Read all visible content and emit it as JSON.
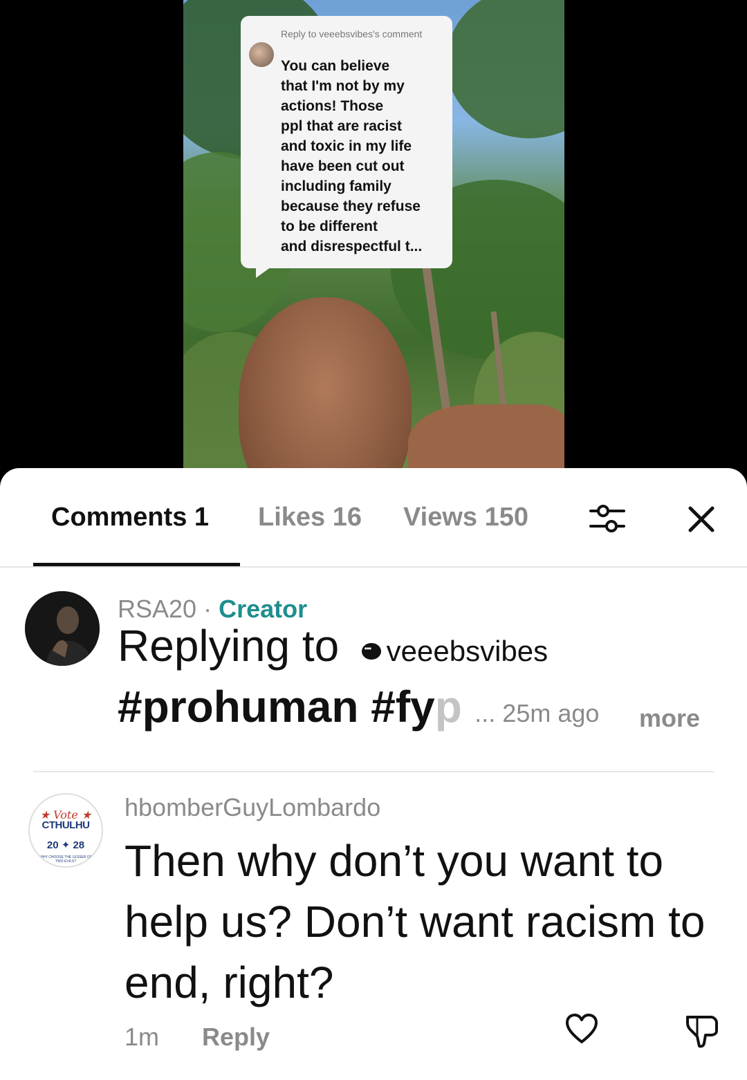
{
  "video": {
    "reply_bubble": {
      "header": "Reply to veeebsvibes's comment",
      "text": "You can believe\nthat I'm not by my\nactions! Those\nppl that are racist\nand toxic in my life\nhave been cut out\nincluding family\nbecause they refuse\nto be different\nand disrespectful t..."
    }
  },
  "tabs": {
    "comments": "Comments 1",
    "likes": "Likes 16",
    "views": "Views 150",
    "filter_icon": "sliders-icon",
    "close_icon": "close-icon"
  },
  "comments": [
    {
      "username": "RSA20",
      "separator": "·",
      "badge": "Creator",
      "replying_label": "Replying to",
      "mention_icon": "chat-bubble-icon",
      "mention": "veeebsvibes",
      "hashtags_main": "#prohuman #fy",
      "hashtags_fade": "p",
      "ellipsis_time": "... 25m ago",
      "more": "more"
    },
    {
      "username": "hbomberGuyLombardo",
      "avatar": {
        "top": "★ Vote ★",
        "name": "CTHULHU",
        "year": "20 ✦ 28",
        "sub": "WHY CHOOSE THE LESSER OF TWO EVILS?"
      },
      "text": "Then why don’t you want to help us? Don’t want racism to end, right?",
      "time": "1m",
      "reply": "Reply",
      "like_icon": "heart-icon",
      "dislike_icon": "thumbs-down-icon"
    }
  ],
  "colors": {
    "creator": "#1e8e8e",
    "muted": "#8a8a8a",
    "text": "#111111"
  }
}
